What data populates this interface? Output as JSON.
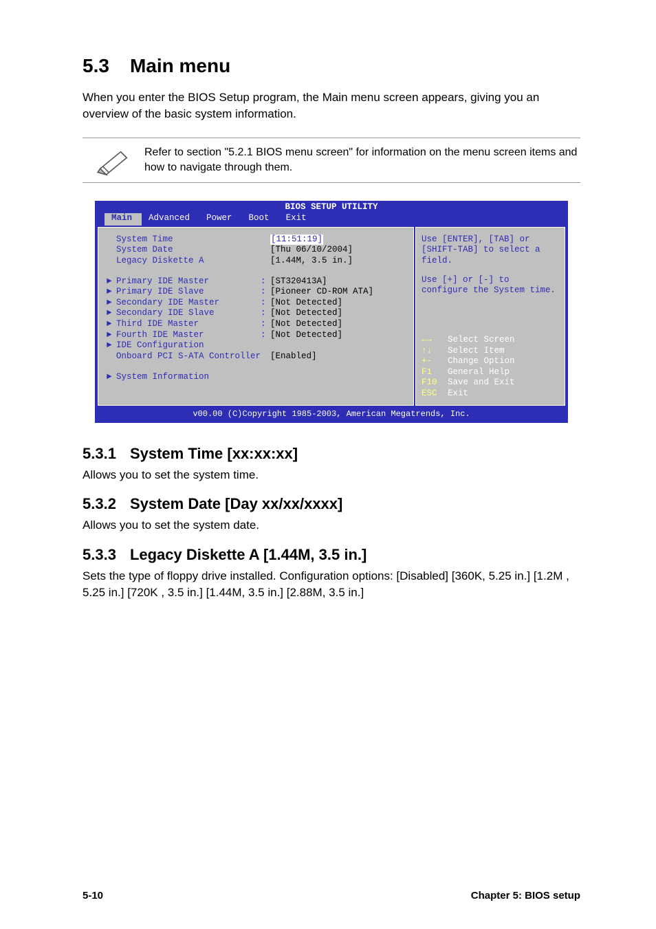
{
  "heading": {
    "number": "5.3",
    "title": "Main menu"
  },
  "intro": "When you enter the BIOS Setup program, the Main menu screen appears, giving you an overview of the basic system information.",
  "note": "Refer to section \"5.2.1 BIOS menu screen\" for information on the menu screen items and how to navigate through them.",
  "bios": {
    "title": "BIOS SETUP UTILITY",
    "tabs": [
      "Main",
      "Advanced",
      "Power",
      "Boot",
      "Exit"
    ],
    "rows_top": [
      {
        "label": "System Time",
        "value": "[11:51:19]",
        "arrow": false,
        "sep": "",
        "highlight": true
      },
      {
        "label": "System Date",
        "value": "[Thu 06/10/2004]",
        "arrow": false,
        "sep": ""
      },
      {
        "label": "Legacy Diskette A",
        "value": "[1.44M, 3.5 in.]",
        "arrow": false,
        "sep": ""
      }
    ],
    "rows_mid": [
      {
        "label": "Primary IDE Master",
        "value": "[ST320413A]",
        "arrow": true,
        "sep": ":"
      },
      {
        "label": "Primary IDE Slave",
        "value": "[Pioneer CD-ROM ATA]",
        "arrow": true,
        "sep": ":"
      },
      {
        "label": "Secondary IDE Master",
        "value": "[Not Detected]",
        "arrow": true,
        "sep": ":"
      },
      {
        "label": "Secondary IDE Slave",
        "value": "[Not Detected]",
        "arrow": true,
        "sep": ":"
      },
      {
        "label": "Third IDE Master",
        "value": "[Not Detected]",
        "arrow": true,
        "sep": ":"
      },
      {
        "label": "Fourth IDE Master",
        "value": "[Not Detected]",
        "arrow": true,
        "sep": ":"
      },
      {
        "label": "IDE Configuration",
        "value": "",
        "arrow": true,
        "sep": ""
      },
      {
        "label": "Onboard PCI S-ATA Controller",
        "value": "[Enabled]",
        "arrow": false,
        "sep": ""
      }
    ],
    "rows_bot": [
      {
        "label": "System Information",
        "value": "",
        "arrow": true,
        "sep": ""
      }
    ],
    "help1": "Use [ENTER], [TAB] or [SHIFT-TAB] to select a field.",
    "help2": "Use [+] or [-] to configure the System time.",
    "legend": [
      {
        "k": "←→",
        "t": "Select Screen"
      },
      {
        "k": "↑↓",
        "t": "Select Item"
      },
      {
        "k": "+-",
        "t": "Change Option"
      },
      {
        "k": "F1",
        "t": "General Help"
      },
      {
        "k": "F10",
        "t": "Save and Exit"
      },
      {
        "k": "ESC",
        "t": "Exit"
      }
    ],
    "copyright": "v00.00 (C)Copyright 1985-2003, American Megatrends, Inc."
  },
  "subsections": [
    {
      "num": "5.3.1",
      "title": "System Time [xx:xx:xx]",
      "body": "Allows you to set the system time."
    },
    {
      "num": "5.3.2",
      "title": "System Date [Day xx/xx/xxxx]",
      "body": "Allows you to set the system date."
    },
    {
      "num": "5.3.3",
      "title": "Legacy Diskette A [1.44M, 3.5 in.]",
      "body": "Sets the type of floppy drive installed. Configuration options: [Disabled] [360K, 5.25 in.] [1.2M , 5.25 in.] [720K , 3.5 in.] [1.44M, 3.5 in.] [2.88M, 3.5 in.]"
    }
  ],
  "footer": {
    "left": "5-10",
    "right": "Chapter 5: BIOS setup"
  }
}
